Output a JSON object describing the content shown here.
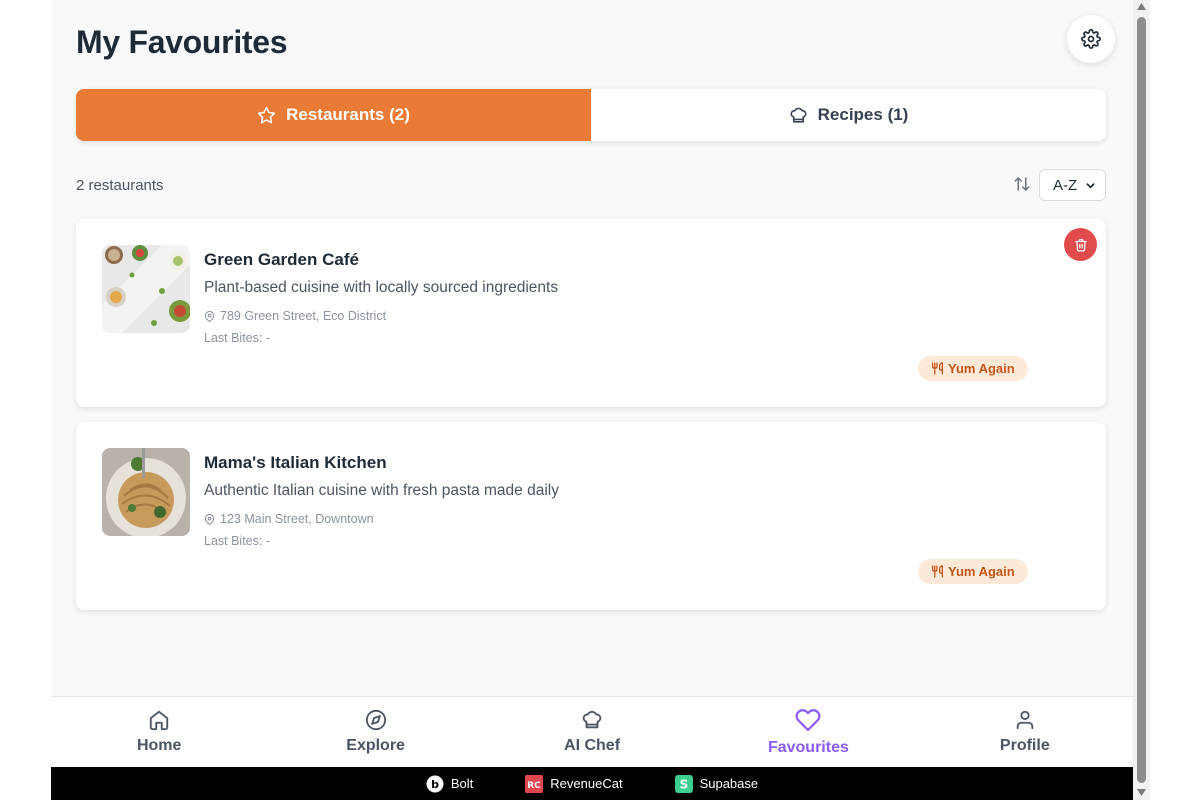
{
  "page": {
    "title": "My Favourites"
  },
  "tabs": [
    {
      "label": "Restaurants (2)",
      "icon": "star-icon",
      "active": true
    },
    {
      "label": "Recipes (1)",
      "icon": "chef-hat-icon",
      "active": false
    }
  ],
  "list": {
    "count_label": "2 restaurants",
    "sort": {
      "selected": "A-Z",
      "options": [
        "A-Z"
      ]
    }
  },
  "restaurants": [
    {
      "name": "Green Garden Café",
      "description": "Plant-based cuisine with locally sourced ingredients",
      "address": "789 Green Street, Eco District",
      "last_bites": "Last Bites: -",
      "tag": "Yum Again"
    },
    {
      "name": "Mama's Italian Kitchen",
      "description": "Authentic Italian cuisine with fresh pasta made daily",
      "address": "123 Main Street, Downtown",
      "last_bites": "Last Bites: -",
      "tag": "Yum Again"
    }
  ],
  "nav": [
    {
      "label": "Home",
      "icon": "home-icon",
      "active": false
    },
    {
      "label": "Explore",
      "icon": "compass-icon",
      "active": false
    },
    {
      "label": "AI Chef",
      "icon": "chef-hat-icon",
      "active": false
    },
    {
      "label": "Favourites",
      "icon": "heart-icon",
      "active": true
    },
    {
      "label": "Profile",
      "icon": "user-icon",
      "active": false
    }
  ],
  "footer": [
    {
      "label": "Bolt",
      "icon": "bolt-logo"
    },
    {
      "label": "RevenueCat",
      "icon": "revenuecat-logo"
    },
    {
      "label": "Supabase",
      "icon": "supabase-logo"
    }
  ],
  "colors": {
    "accent": "#e97b36",
    "nav_active": "#8b5cf6",
    "delete": "#e14b4b",
    "tag_bg": "#fde9d7",
    "tag_text": "#c4561b"
  }
}
